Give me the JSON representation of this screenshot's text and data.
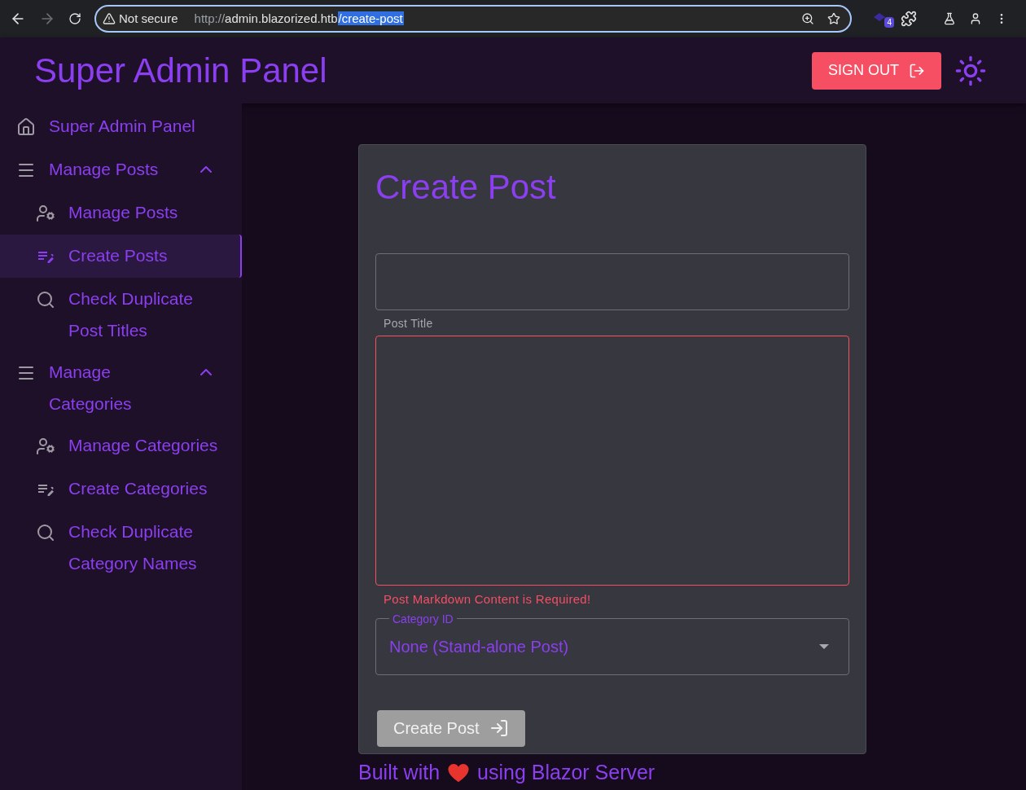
{
  "browser": {
    "security": "Not secure",
    "url_prefix": "http://",
    "url_host": "admin.blazorized.htb",
    "url_selected": "/create-post",
    "extension_badge": "4"
  },
  "header": {
    "title": "Super Admin Panel",
    "sign_out": "SIGN OUT"
  },
  "sidebar": {
    "items": [
      {
        "kind": "home",
        "label": "Super Admin Panel",
        "selected": false
      },
      {
        "kind": "group",
        "label": "Manage Posts",
        "expanded": true,
        "children": [
          {
            "kind": "manage",
            "label": "Manage Posts",
            "selected": false
          },
          {
            "kind": "create",
            "label": "Create Posts",
            "selected": true
          },
          {
            "kind": "check",
            "label": "Check Duplicate Post Titles",
            "selected": false
          }
        ]
      },
      {
        "kind": "group",
        "label": "Manage Categories",
        "expanded": true,
        "children": [
          {
            "kind": "manage",
            "label": "Manage Categories",
            "selected": false
          },
          {
            "kind": "create",
            "label": "Create Categories",
            "selected": false
          },
          {
            "kind": "check",
            "label": "Check Duplicate Category Names",
            "selected": false
          }
        ]
      }
    ]
  },
  "form": {
    "title": "Create Post",
    "post_title": {
      "helper": "Post Title"
    },
    "content": {
      "error": "Post Markdown Content is Required!"
    },
    "category": {
      "label": "Category ID",
      "value": "None (Stand-alone Post)"
    },
    "submit": {
      "label": "Create Post",
      "disabled": true
    }
  },
  "footer": {
    "before": "Built with",
    "after": "using Blazor Server"
  }
}
